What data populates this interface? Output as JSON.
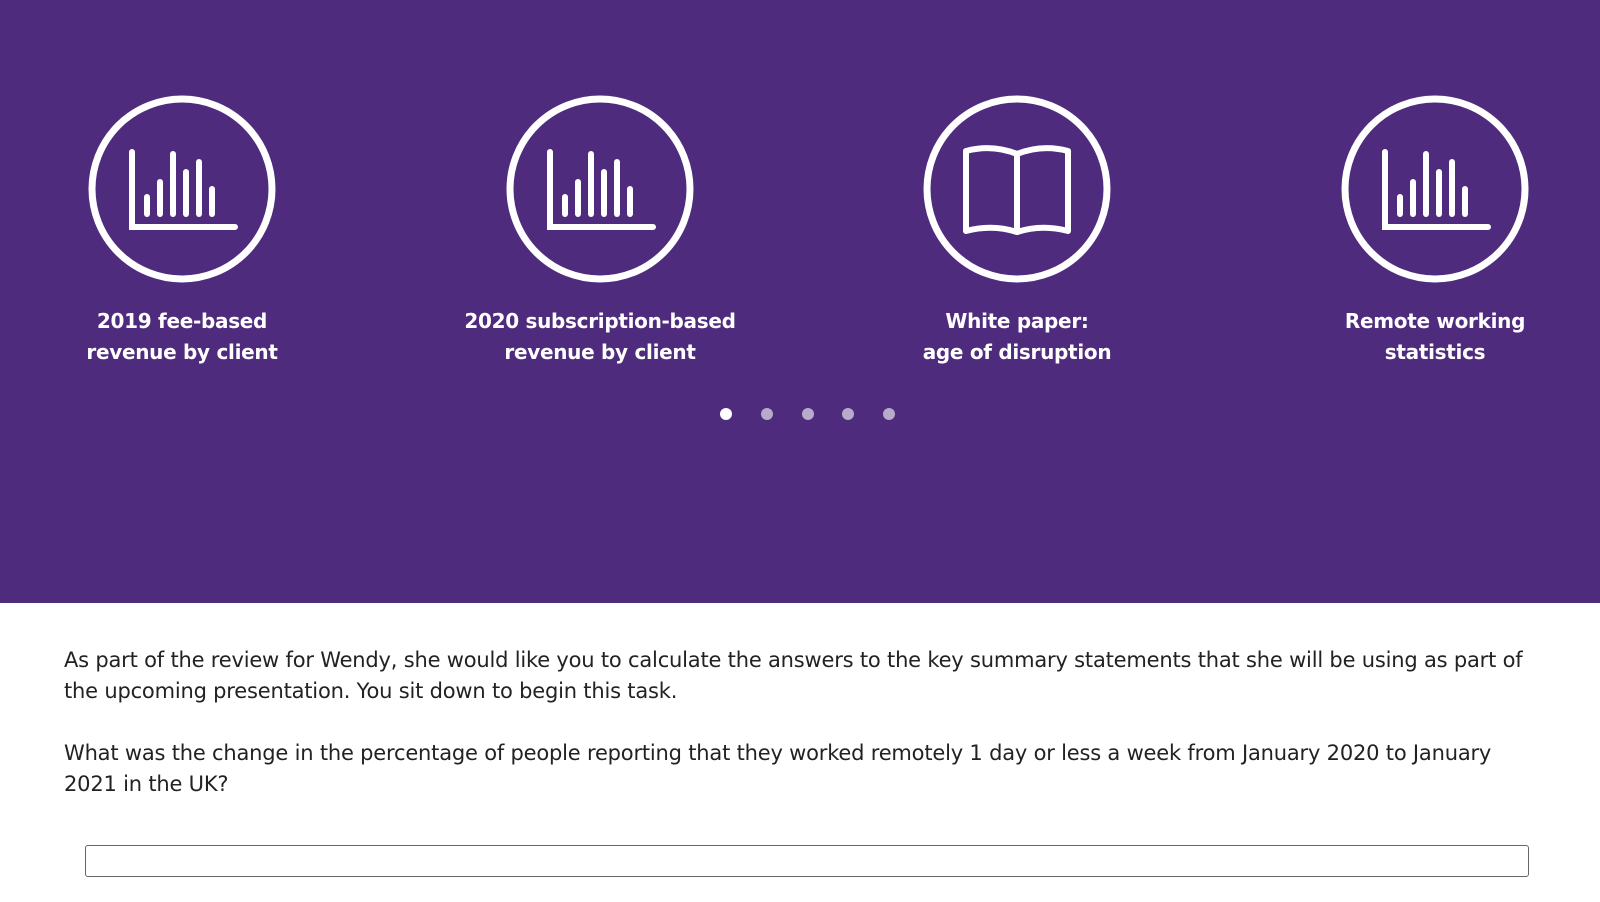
{
  "colors": {
    "hero_background": "#4e2b7c",
    "icon_stroke": "#ffffff",
    "text": "#222222"
  },
  "resources": [
    {
      "icon": "bar-chart-icon",
      "line1": "2019 fee-based",
      "line2": "revenue by client"
    },
    {
      "icon": "bar-chart-icon",
      "line1": "2020 subscription-based",
      "line2": "revenue by client"
    },
    {
      "icon": "open-book-icon",
      "line1": "White paper:",
      "line2": "age of disruption"
    },
    {
      "icon": "bar-chart-icon",
      "line1": "Remote working",
      "line2": "statistics"
    }
  ],
  "carousel": {
    "page_count": 5,
    "active_page": 1
  },
  "task": {
    "intro": "As part of the review for Wendy, she would like you to calculate the answers to the key summary statements that she will be using as part of the upcoming presentation. You sit down to begin this task.",
    "question": "What was the change in the percentage of people reporting that they worked remotely 1 day or less a week from January 2020 to January 2021 in the UK?"
  },
  "answer": {
    "value": ""
  }
}
